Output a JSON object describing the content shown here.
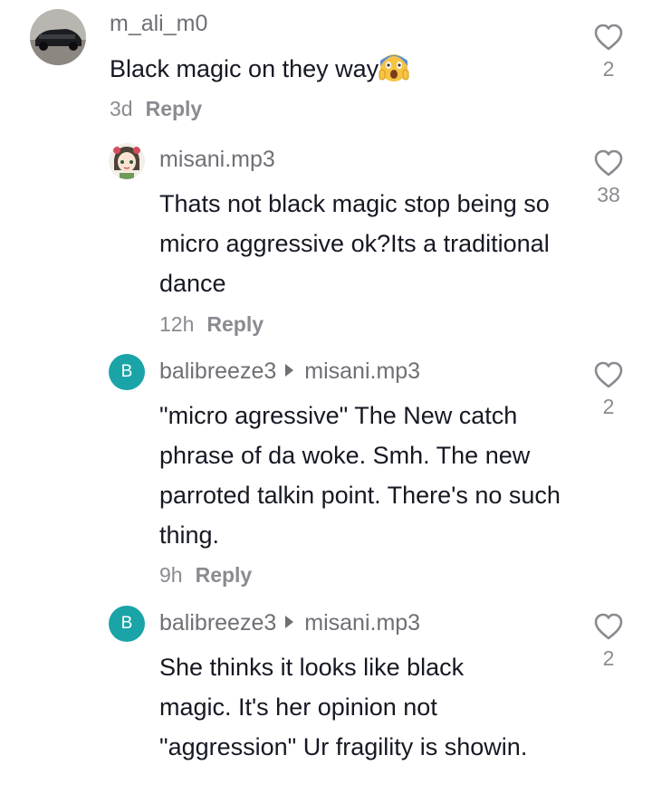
{
  "comments": [
    {
      "username": "m_ali_m0",
      "text": "Black magic on they way",
      "emoji": "screaming-face-emoji",
      "time": "3d",
      "reply": "Reply",
      "likes": "2",
      "avatar": "car-photo-avatar"
    },
    {
      "username": "misani.mp3",
      "text": "Thats not black magic stop being so micro aggressive ok?Its a traditional dance",
      "time": "12h",
      "reply": "Reply",
      "likes": "38",
      "avatar": "anime-girl-avatar"
    },
    {
      "username": "balibreeze3",
      "reply_to": "misani.mp3",
      "avatar_letter": "B",
      "text": "\"micro agressive\" The New catch phrase of da woke. Smh. The new parroted talkin point. There's no such thing.",
      "time": "9h",
      "reply": "Reply",
      "likes": "2"
    },
    {
      "username": "balibreeze3",
      "reply_to": "misani.mp3",
      "avatar_letter": "B",
      "text": "She thinks it looks like black magic. It's her opinion not \"aggression\" Ur fragility is showin.",
      "likes": "2"
    }
  ],
  "colors": {
    "avatar_teal": "#1aa4a8",
    "text": "#161823",
    "muted": "#8a8b91"
  }
}
